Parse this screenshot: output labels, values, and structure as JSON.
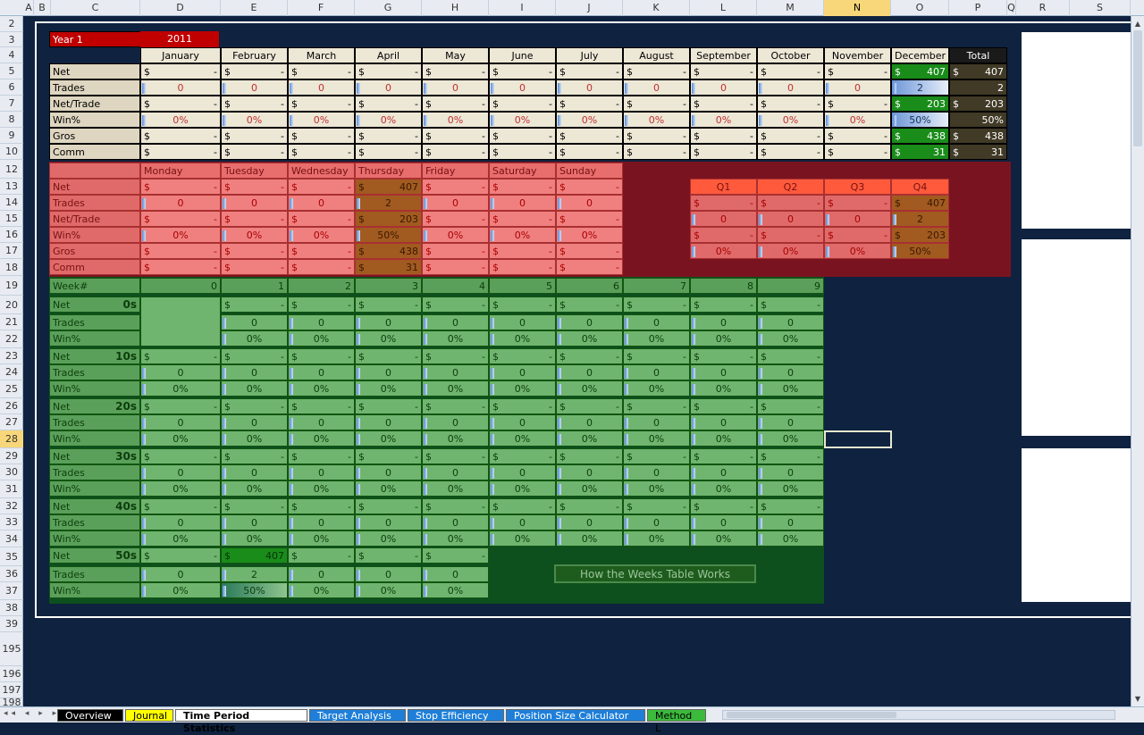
{
  "columns": [
    "A",
    "B",
    "C",
    "D",
    "E",
    "F",
    "G",
    "H",
    "I",
    "J",
    "K",
    "L",
    "M",
    "N",
    "O",
    "P",
    "Q",
    "R",
    "S"
  ],
  "selected_column": "N",
  "rows": [
    "2",
    "3",
    "4",
    "5",
    "6",
    "7",
    "8",
    "9",
    "10",
    "12",
    "13",
    "14",
    "15",
    "16",
    "17",
    "18",
    "19",
    "20",
    "21",
    "22",
    "23",
    "24",
    "25",
    "26",
    "27",
    "28",
    "29",
    "30",
    "31",
    "32",
    "33",
    "34",
    "35",
    "36",
    "37",
    "38",
    "39",
    "195",
    "196",
    "197",
    "198"
  ],
  "selected_row": "28",
  "year": {
    "label": "Year 1",
    "value": "2011"
  },
  "months": [
    "January",
    "February",
    "March",
    "April",
    "May",
    "June",
    "July",
    "August",
    "September",
    "October",
    "November",
    "December"
  ],
  "total_label": "Total",
  "month_rows": [
    {
      "label": "Net",
      "kind": "money",
      "values": [
        "-",
        "-",
        "-",
        "-",
        "-",
        "-",
        "-",
        "-",
        "-",
        "-",
        "-",
        "407"
      ],
      "total": "407"
    },
    {
      "label": "Trades",
      "kind": "num",
      "values": [
        "0",
        "0",
        "0",
        "0",
        "0",
        "0",
        "0",
        "0",
        "0",
        "0",
        "0",
        "2"
      ],
      "total": "2"
    },
    {
      "label": "Net/Trade",
      "kind": "money",
      "values": [
        "-",
        "-",
        "-",
        "-",
        "-",
        "-",
        "-",
        "-",
        "-",
        "-",
        "-",
        "203"
      ],
      "total": "203"
    },
    {
      "label": "Win%",
      "kind": "num",
      "values": [
        "0%",
        "0%",
        "0%",
        "0%",
        "0%",
        "0%",
        "0%",
        "0%",
        "0%",
        "0%",
        "0%",
        "50%"
      ],
      "total": "50%"
    },
    {
      "label": "Gros",
      "kind": "money",
      "values": [
        "-",
        "-",
        "-",
        "-",
        "-",
        "-",
        "-",
        "-",
        "-",
        "-",
        "-",
        "438"
      ],
      "total": "438"
    },
    {
      "label": "Comm",
      "kind": "money",
      "values": [
        "-",
        "-",
        "-",
        "-",
        "-",
        "-",
        "-",
        "-",
        "-",
        "-",
        "-",
        "31"
      ],
      "total": "31"
    }
  ],
  "days": [
    "Monday",
    "Tuesday",
    "Wednesday",
    "Thursday",
    "Friday",
    "Saturday",
    "Sunday"
  ],
  "day_rows": [
    {
      "label": "Net",
      "kind": "money",
      "values": [
        "-",
        "-",
        "-",
        "407",
        "-",
        "-",
        "-"
      ]
    },
    {
      "label": "Trades",
      "kind": "num",
      "values": [
        "0",
        "0",
        "0",
        "2",
        "0",
        "0",
        "0"
      ]
    },
    {
      "label": "Net/Trade",
      "kind": "money",
      "values": [
        "-",
        "-",
        "-",
        "203",
        "-",
        "-",
        "-"
      ]
    },
    {
      "label": "Win%",
      "kind": "num",
      "values": [
        "0%",
        "0%",
        "0%",
        "50%",
        "0%",
        "0%",
        "0%"
      ]
    },
    {
      "label": "Gros",
      "kind": "money",
      "values": [
        "-",
        "-",
        "-",
        "438",
        "-",
        "-",
        "-"
      ]
    },
    {
      "label": "Comm",
      "kind": "money",
      "values": [
        "-",
        "-",
        "-",
        "31",
        "-",
        "-",
        "-"
      ]
    }
  ],
  "quarters": [
    "Q1",
    "Q2",
    "Q3",
    "Q4"
  ],
  "quarter_rows": [
    {
      "kind": "money",
      "values": [
        "-",
        "-",
        "-",
        "407"
      ]
    },
    {
      "kind": "num",
      "values": [
        "0",
        "0",
        "0",
        "2"
      ]
    },
    {
      "kind": "money",
      "values": [
        "-",
        "-",
        "-",
        "203"
      ]
    },
    {
      "kind": "num",
      "values": [
        "0%",
        "0%",
        "0%",
        "50%"
      ]
    }
  ],
  "week_header": {
    "label": "Week#",
    "digits": [
      "0",
      "1",
      "2",
      "3",
      "4",
      "5",
      "6",
      "7",
      "8",
      "9"
    ]
  },
  "week_groups": [
    {
      "decade": "0s"
    },
    {
      "decade": "10s"
    },
    {
      "decade": "20s"
    },
    {
      "decade": "30s"
    },
    {
      "decade": "40s"
    },
    {
      "decade": "50s"
    }
  ],
  "week_row_labels": [
    "Net",
    "Trades",
    "Win%"
  ],
  "week_values": {
    "net": "-",
    "trades": "0",
    "win": "0%",
    "hot_net": "407",
    "hot_trades": "2",
    "hot_win": "50%"
  },
  "currency_symbol": "$",
  "help_button": "How the Weeks Table Works",
  "tabs": [
    {
      "label": "Overview",
      "color": "#000000",
      "text": "#ffffff"
    },
    {
      "label": "Journal",
      "color": "#ffff00",
      "text": "#000000"
    },
    {
      "label": "Time Period Statistics",
      "color": "#ffffff",
      "text": "#000000",
      "active": true
    },
    {
      "label": "Target Analysis",
      "color": "#1f7fd8",
      "text": "#ffffff"
    },
    {
      "label": "Stop Efficiency",
      "color": "#1f7fd8",
      "text": "#ffffff"
    },
    {
      "label": "Position Size Calculator",
      "color": "#1f7fd8",
      "text": "#ffffff"
    },
    {
      "label": "Method L",
      "color": "#3cba3c",
      "text": "#000000"
    }
  ]
}
